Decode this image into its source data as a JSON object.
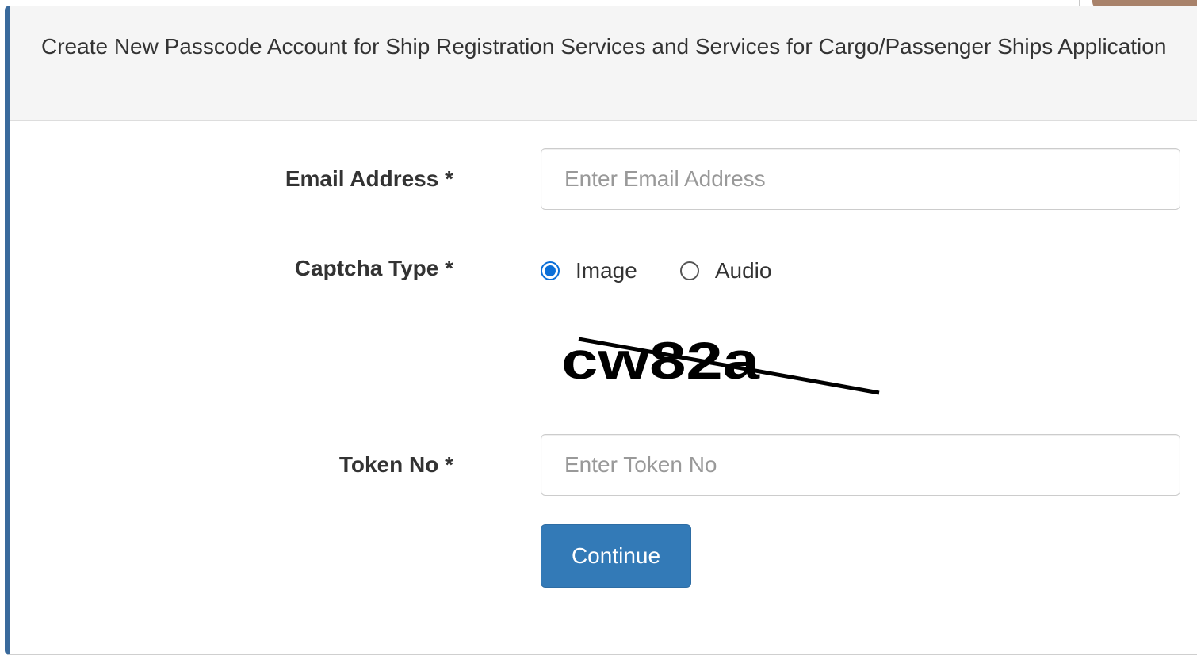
{
  "panel": {
    "title": "Create New Passcode Account for Ship Registration Services and Services for Cargo/Passenger Ships Application"
  },
  "form": {
    "email": {
      "label": "Email Address *",
      "placeholder": "Enter Email Address",
      "value": ""
    },
    "captcha_type": {
      "label": "Captcha Type *",
      "options": [
        {
          "label": "Image",
          "checked": true
        },
        {
          "label": "Audio",
          "checked": false
        }
      ]
    },
    "captcha": {
      "text": "cw82a"
    },
    "token": {
      "label": "Token No *",
      "placeholder": "Enter Token No",
      "value": ""
    },
    "submit_label": "Continue"
  },
  "colors": {
    "primary": "#337ab7",
    "radio_accent": "#0b6fd8",
    "panel_border_accent": "#3a6a9c",
    "heading_bg": "#f5f5f5"
  }
}
